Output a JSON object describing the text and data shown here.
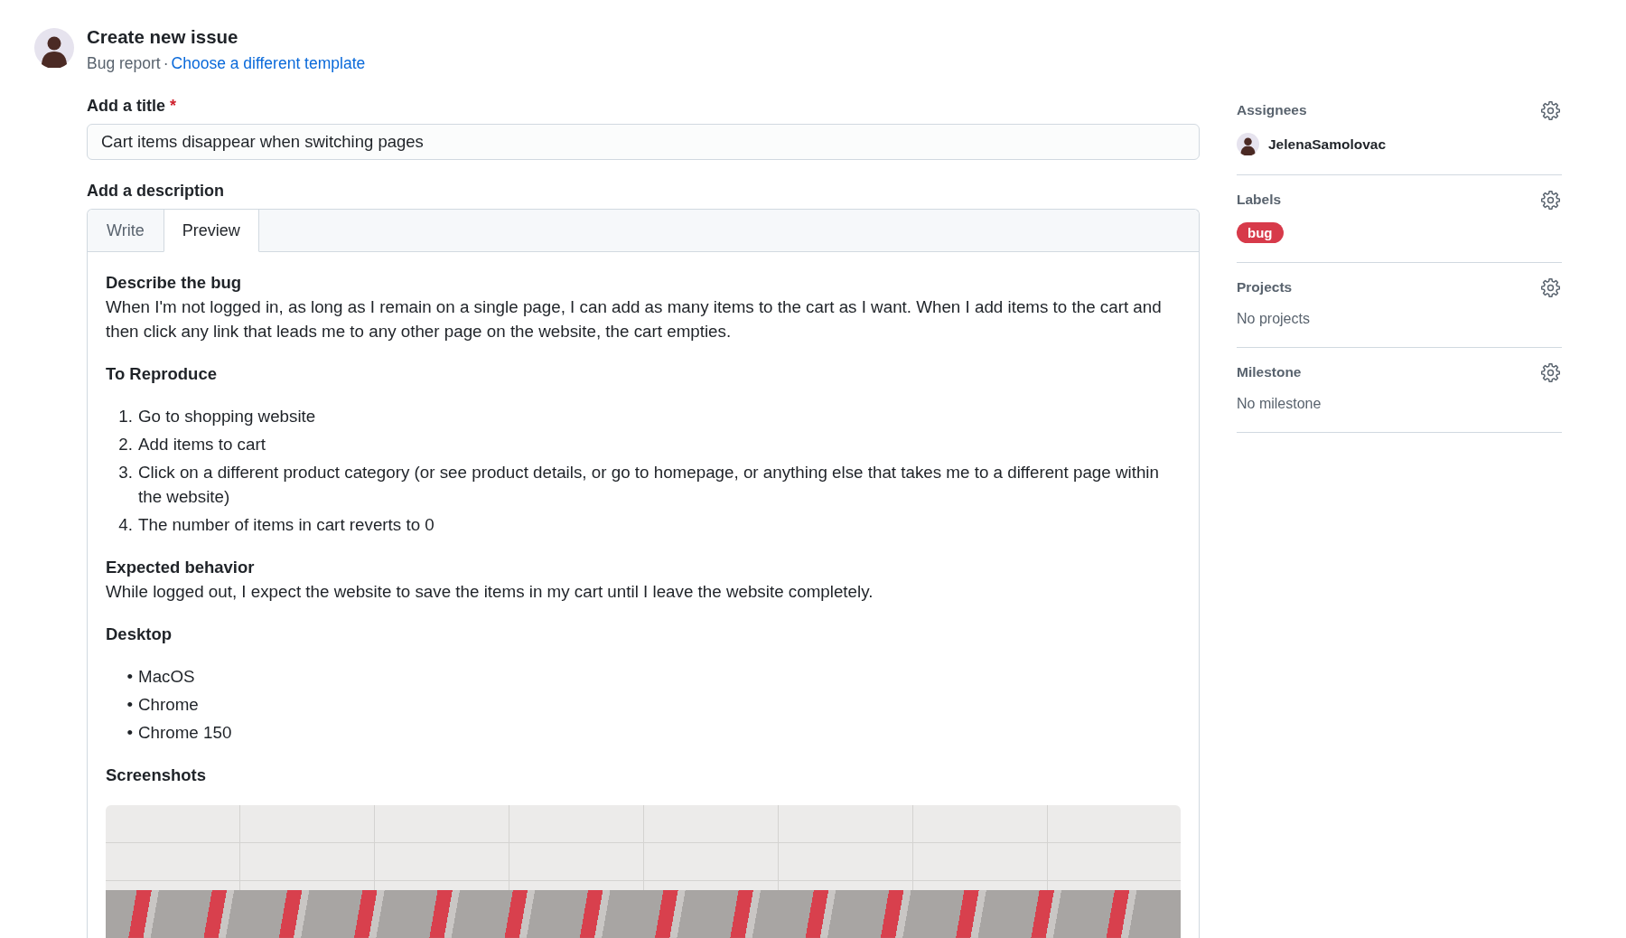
{
  "header": {
    "title": "Create new issue",
    "template": "Bug report",
    "separator": "·",
    "template_link": "Choose a different template"
  },
  "title_field": {
    "label": "Add a title",
    "required_mark": "*",
    "value": "Cart items disappear when switching pages"
  },
  "description": {
    "label": "Add a description",
    "tabs": [
      {
        "label": "Write",
        "selected": false
      },
      {
        "label": "Preview",
        "selected": true
      }
    ],
    "blocks": [
      {
        "kind": "heading",
        "text": "Describe the bug"
      },
      {
        "kind": "paragraph",
        "text": "When I'm not logged in, as long as I remain on a single page, I can add as many items to the cart as I want. When I add items to the cart and then click any link that leads me to any other page on the website, the cart empties."
      },
      {
        "kind": "heading",
        "text": "To Reproduce"
      },
      {
        "kind": "list",
        "items": [
          {
            "marker": "1.",
            "text": "Go to shopping website"
          },
          {
            "marker": "2.",
            "text": "Add items to cart"
          },
          {
            "marker": "3.",
            "text": "Click on a different product category (or see product details, or go to homepage, or anything else that takes me to a different page within the website)"
          },
          {
            "marker": "4.",
            "text": "The number of items in cart reverts to 0"
          }
        ]
      },
      {
        "kind": "heading",
        "text": "Expected behavior"
      },
      {
        "kind": "paragraph",
        "text": "While logged out, I expect the website to save the items in my cart until I leave the website completely."
      },
      {
        "kind": "heading",
        "text": "Desktop"
      },
      {
        "kind": "list",
        "items": [
          {
            "marker": "•",
            "text": "MacOS"
          },
          {
            "marker": "•",
            "text": "Chrome"
          },
          {
            "marker": "•",
            "text": "Chrome 150"
          }
        ]
      },
      {
        "kind": "heading",
        "text": "Screenshots"
      },
      {
        "kind": "image"
      }
    ]
  },
  "sidebar": {
    "sections": [
      {
        "title": "Assignees",
        "kind": "users",
        "users": [
          {
            "name": "JelenaSamolovac"
          }
        ]
      },
      {
        "title": "Labels",
        "kind": "labels",
        "labels": [
          {
            "name": "bug",
            "color": "#d73a4a"
          }
        ]
      },
      {
        "title": "Projects",
        "kind": "empty",
        "text": "No projects"
      },
      {
        "title": "Milestone",
        "kind": "empty",
        "text": "No milestone"
      }
    ]
  }
}
